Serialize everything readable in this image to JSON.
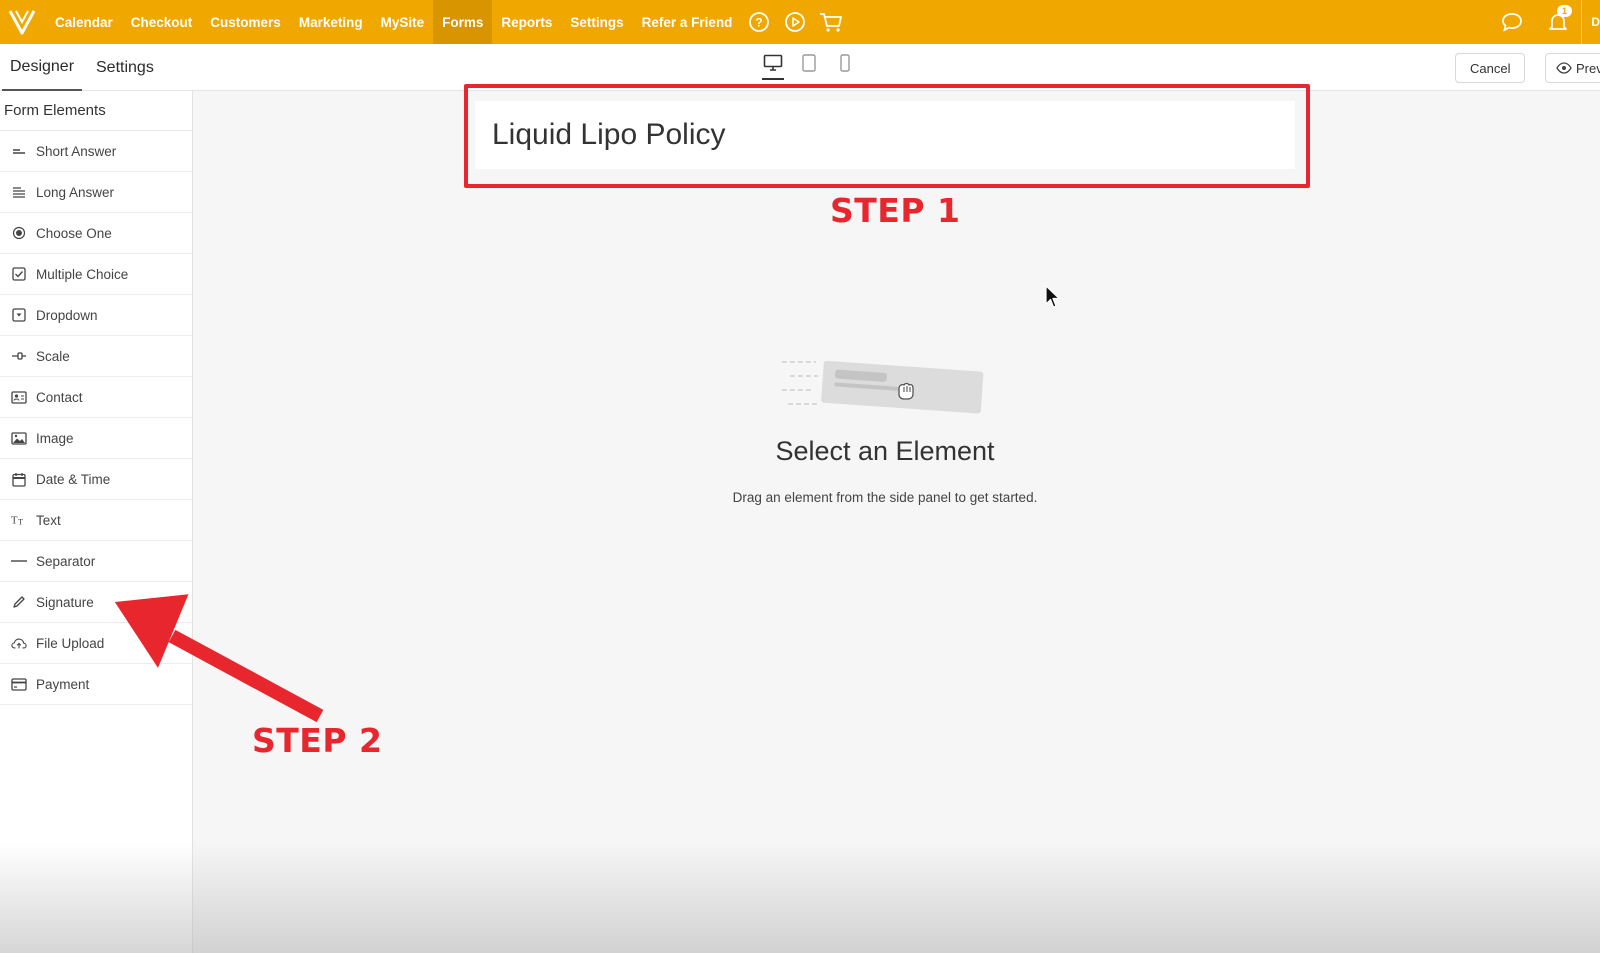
{
  "topnav": {
    "items": [
      {
        "label": "Calendar"
      },
      {
        "label": "Checkout"
      },
      {
        "label": "Customers"
      },
      {
        "label": "Marketing"
      },
      {
        "label": "MySite"
      },
      {
        "label": "Forms",
        "active": true
      },
      {
        "label": "Reports"
      },
      {
        "label": "Settings"
      },
      {
        "label": "Refer a Friend"
      }
    ],
    "icons": [
      "help-icon",
      "play-icon",
      "cart-icon"
    ],
    "right_icons": [
      "chat-icon",
      "bell-icon"
    ],
    "notification_count": "1",
    "user_initial": "D",
    "accent_color": "#f0a800"
  },
  "subheader": {
    "tabs": [
      {
        "label": "Designer",
        "active": true
      },
      {
        "label": "Settings"
      }
    ],
    "devices": [
      "desktop-icon",
      "tablet-icon",
      "mobile-icon"
    ],
    "cancel_label": "Cancel",
    "preview_label": "Prev"
  },
  "sidebar": {
    "title": "Form Elements",
    "items": [
      {
        "label": "Short Answer",
        "icon": "short-answer-icon"
      },
      {
        "label": "Long Answer",
        "icon": "long-answer-icon"
      },
      {
        "label": "Choose One",
        "icon": "radio-icon"
      },
      {
        "label": "Multiple Choice",
        "icon": "checkbox-icon"
      },
      {
        "label": "Dropdown",
        "icon": "dropdown-icon"
      },
      {
        "label": "Scale",
        "icon": "scale-icon"
      },
      {
        "label": "Contact",
        "icon": "contact-card-icon"
      },
      {
        "label": "Image",
        "icon": "image-icon"
      },
      {
        "label": "Date & Time",
        "icon": "calendar-icon"
      },
      {
        "label": "Text",
        "icon": "text-icon"
      },
      {
        "label": "Separator",
        "icon": "separator-icon"
      },
      {
        "label": "Signature",
        "icon": "pen-icon"
      },
      {
        "label": "File Upload",
        "icon": "cloud-upload-icon"
      },
      {
        "label": "Payment",
        "icon": "credit-card-icon"
      }
    ]
  },
  "canvas": {
    "form_title": "Liquid Lipo Policy",
    "empty_title": "Select an Element",
    "empty_subtitle": "Drag an element from the side panel to get started."
  },
  "annotations": {
    "step1": "STEP 1",
    "step2": "STEP 2",
    "color": "#e8262e"
  }
}
